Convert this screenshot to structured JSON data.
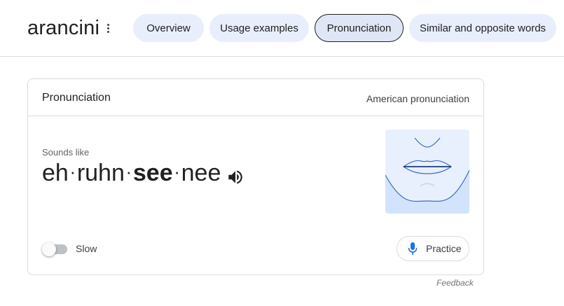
{
  "header": {
    "word": "arancini",
    "chips": [
      {
        "label": "Overview",
        "selected": false
      },
      {
        "label": "Usage examples",
        "selected": false
      },
      {
        "label": "Pronunciation",
        "selected": true
      },
      {
        "label": "Similar and opposite words",
        "selected": false
      }
    ]
  },
  "card": {
    "title": "Pronunciation",
    "accent": "American pronunciation",
    "sounds_like_label": "Sounds like",
    "syllables": [
      {
        "text": "eh",
        "stressed": false
      },
      {
        "text": "ruhn",
        "stressed": false
      },
      {
        "text": "see",
        "stressed": true
      },
      {
        "text": "nee",
        "stressed": false
      }
    ],
    "separator": "·",
    "speaker_icon": "volume-icon",
    "slow_label": "Slow",
    "slow_enabled": false,
    "practice_label": "Practice",
    "practice_icon": "microphone-icon"
  },
  "feedback_label": "Feedback",
  "colors": {
    "chip_bg": "#e8eefb",
    "chip_selected_border": "#1f1f1f",
    "mic_blue": "#1a73e8",
    "mouth_bg_light": "#e8f0fe",
    "mouth_bg_dark": "#d2e3fc",
    "mouth_line": "#3c6ec4"
  }
}
